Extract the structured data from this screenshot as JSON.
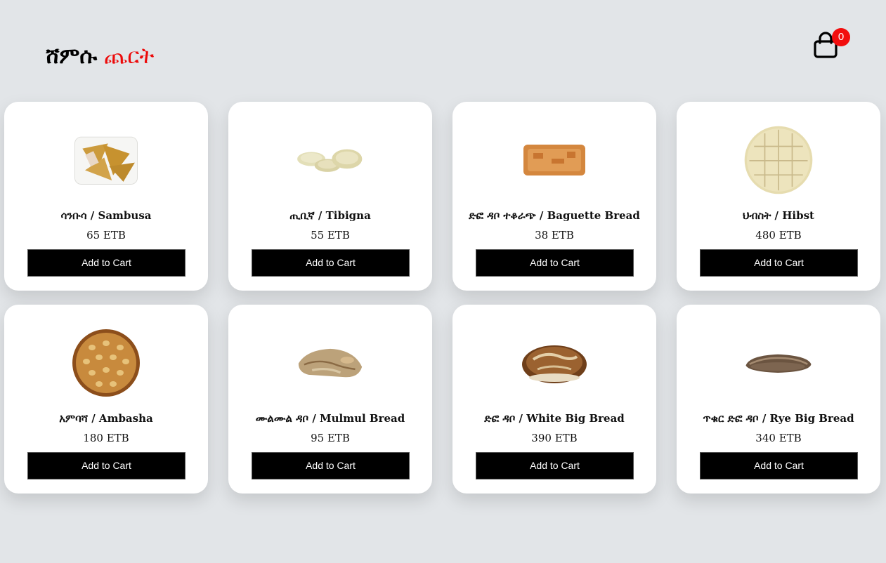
{
  "header": {
    "logo_first": "ሸምሱ",
    "logo_second": "ጨርት",
    "cart_count": "0",
    "cart_icon": "shopping-bag-icon"
  },
  "colors": {
    "background": "#e2e5e8",
    "accent_red": "#ec0a0a",
    "button": "#000000"
  },
  "products": [
    {
      "name": "ሳንቡሳ / Sambusa",
      "price": "65 ETB",
      "button": "Add to Cart",
      "image": "sambusa"
    },
    {
      "name": "ጢቢኛ / Tibigna",
      "price": "55 ETB",
      "button": "Add to Cart",
      "image": "tibigna"
    },
    {
      "name": "ድፎ ዳቦ ተቆራጭ / Baguette Bread",
      "price": "38 ETB",
      "button": "Add to Cart",
      "image": "baguette-bread"
    },
    {
      "name": "ህብስት / Hibst",
      "price": "480 ETB",
      "button": "Add to Cart",
      "image": "hibst"
    },
    {
      "name": "አምባሻ / Ambasha",
      "price": "180 ETB",
      "button": "Add to Cart",
      "image": "ambasha"
    },
    {
      "name": "ሙልሙል ዳቦ / Mulmul Bread",
      "price": "95 ETB",
      "button": "Add to Cart",
      "image": "mulmul-bread"
    },
    {
      "name": "ድፎ ዳቦ / White Big Bread",
      "price": "390 ETB",
      "button": "Add to Cart",
      "image": "white-big-bread"
    },
    {
      "name": "ጥቁር ድፎ ዳቦ / Rye Big Bread",
      "price": "340 ETB",
      "button": "Add to Cart",
      "image": "rye-big-bread"
    }
  ]
}
